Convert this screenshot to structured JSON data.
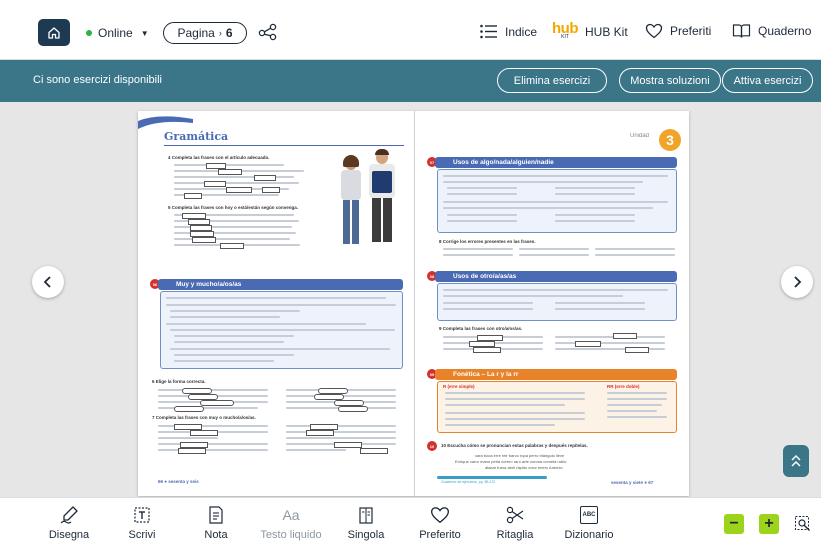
{
  "topbar": {
    "status": "Online",
    "page_label": "Pagina",
    "page_number": "6",
    "tools": {
      "indice": "Indice",
      "hub_kit": "HUB Kit",
      "hub_logo": "hub",
      "hub_logo_sub": "KIT",
      "preferiti": "Preferiti",
      "quaderno": "Quaderno"
    }
  },
  "subbar": {
    "message": "Ci sono esercizi disponibili",
    "elimina": "Elimina esercizi",
    "mostra": "Mostra soluzioni",
    "attiva": "Attiva esercizi"
  },
  "book": {
    "left_title": "Gramática",
    "unit_label": "Unidad",
    "unit_number": "3",
    "ex4": "4 Completa las frases con el artículo adecuado.",
    "ex5": "5 Completa las frases con hoy o está/están según convenga.",
    "sec_muy": "Muy y mucho/a/os/as",
    "ex6": "6 Elige la forma correcta.",
    "ex7": "7 Completa las frases con muy o mucho/a/os/as.",
    "left_footer": "66 ● sesenta y seis",
    "sec_algo": "Usos de algo/nada/alguien/nadie",
    "ex8": "8 Corrige los errores presentes en las frases.",
    "sec_otro": "Usos de otro/a/as/as",
    "ex9": "9 Completa las frases con otro/a/os/as.",
    "sec_fonetica": "Fonética – La r y la rr",
    "r_simple": "R (erre simple)",
    "rr_doble": "RR (erre doble)",
    "ex10": "10 Escucha cómo se pronuncian estas palabras y después repítelas.",
    "words1": "cara  boca  erre  reir  barco  ropa  perro  triángulo  lleve",
    "words2": "Enrique  carro  mano  perla  correo  raro  arte  corona  cometa  rubio",
    "words3": "atacar  fuera  abril  rápido  error  enero  Antonio",
    "right_footer": "sesenta y siete ● 67",
    "cuaderno": "Cuaderno de ejercicios, pp. 85-137"
  },
  "bottombar": {
    "disegna": "Disegna",
    "scrivi": "Scrivi",
    "nota": "Nota",
    "testo_liquido": "Testo liquido",
    "testo_liquido_glyph": "Aa",
    "singola": "Singola",
    "preferito": "Preferito",
    "ritaglia": "Ritaglia",
    "dizionario": "Dizionario",
    "dizionario_glyph": "ABC"
  },
  "colors": {
    "teal": "#3a7588",
    "navy": "#1d3a52",
    "online_green": "#2bb34a",
    "zoom_green": "#9bd41a",
    "section_blue": "#4a6bb3",
    "section_orange": "#e8832a",
    "bullet_red": "#d2312e"
  },
  "icons": {
    "home": "home-icon",
    "share": "share-icon",
    "indice": "list-icon",
    "heart": "heart-icon",
    "book": "book-open-icon",
    "prev": "chevron-left-icon",
    "next": "chevron-right-icon",
    "up": "chevron-up-icon",
    "draw": "pen-icon",
    "scrivi": "text-box-icon",
    "nota": "note-icon",
    "singola": "single-page-icon",
    "ritaglia": "scissors-icon",
    "dizionario": "dictionary-icon",
    "zoom_out": "minus-icon",
    "zoom_in": "plus-icon",
    "zoom_area": "zoom-area-icon"
  }
}
